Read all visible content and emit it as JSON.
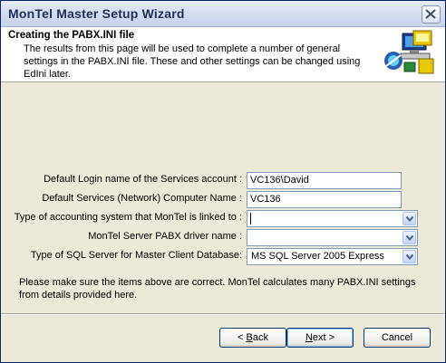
{
  "window": {
    "title": "MonTel Master Setup Wizard"
  },
  "header": {
    "title": "Creating the PABX.INI file",
    "description": "The results from this page will be used to complete a number of general settings in the PABX.INI file.  These and other settings can be changed using EdIni later."
  },
  "form": {
    "login_label": "Default Login name of the Services account :",
    "login_value": "VC136\\David",
    "computer_label": "Default Services (Network) Computer Name :",
    "computer_value": "VC136",
    "accounting_label": "Type of accounting system that MonTel is linked to :",
    "accounting_value": "",
    "driver_label": "MonTel Server PABX driver name :",
    "driver_value": "",
    "sql_label": "Type of SQL Server for Master Client Database:",
    "sql_value": "MS SQL Server 2005 Express"
  },
  "note": "Please make sure the items above are correct. MonTel calculates many PABX.INI settings from details provided here.",
  "buttons": {
    "back_prefix": "< ",
    "back_key": "B",
    "back_rest": "ack",
    "next_key": "N",
    "next_rest": "ext >",
    "cancel": "Cancel"
  },
  "icons": {
    "close": "close-icon",
    "wizard": "computer-setup-icon",
    "dropdown": "chevron-down-icon"
  }
}
